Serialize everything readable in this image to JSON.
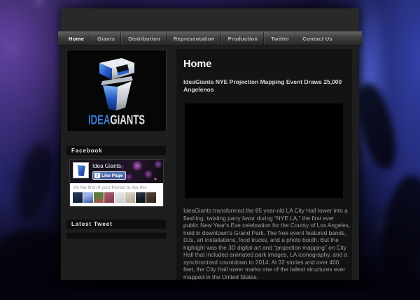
{
  "nav": {
    "items": [
      {
        "label": "Home",
        "active": true
      },
      {
        "label": "Giants",
        "active": false
      },
      {
        "label": "Distribution",
        "active": false
      },
      {
        "label": "Representation",
        "active": false
      },
      {
        "label": "Production",
        "active": false
      },
      {
        "label": "Twitter",
        "active": false
      },
      {
        "label": "Contact Us",
        "active": false
      }
    ]
  },
  "logo": {
    "text_primary": "IDEA",
    "text_secondary": "GIANTS"
  },
  "sidebar": {
    "facebook": {
      "heading": "Facebook",
      "page_name": "Idea Giants",
      "like_button_label": "Like Page",
      "like_glyph": "f",
      "social_text": "Be the first of your friends to like this"
    },
    "latest_tweet": {
      "heading": "Latest Tweet"
    }
  },
  "main": {
    "page_title": "Home",
    "article": {
      "title": "IdeaGiants NYE Projection Mapping Event Draws 25,000 Angelenos",
      "body": "IdeaGiants transformed the 85 year-old LA City Hall tower into a flashing, twisting party favor during “NYE LA,” the first ever public New Year's Eve celebration for the County of Los Angeles, held in downtown's Grand Park. The free event featured bands, DJs, art installations, food trucks, and a photo booth. But the highlight was the 3D digital art and “projection mapping” on City Hall that included animated park images, LA iconography, and a synchronized countdown to 2014. At 32 stories and over 400 feet, the City Hall tower marks one of the tallest structures ever mapped in the United States."
    }
  },
  "colors": {
    "logo_blue": "#3a7bd5",
    "facebook_blue": "#3b5998",
    "page_background": "#1e1e1e",
    "content_panel": "#131313"
  }
}
